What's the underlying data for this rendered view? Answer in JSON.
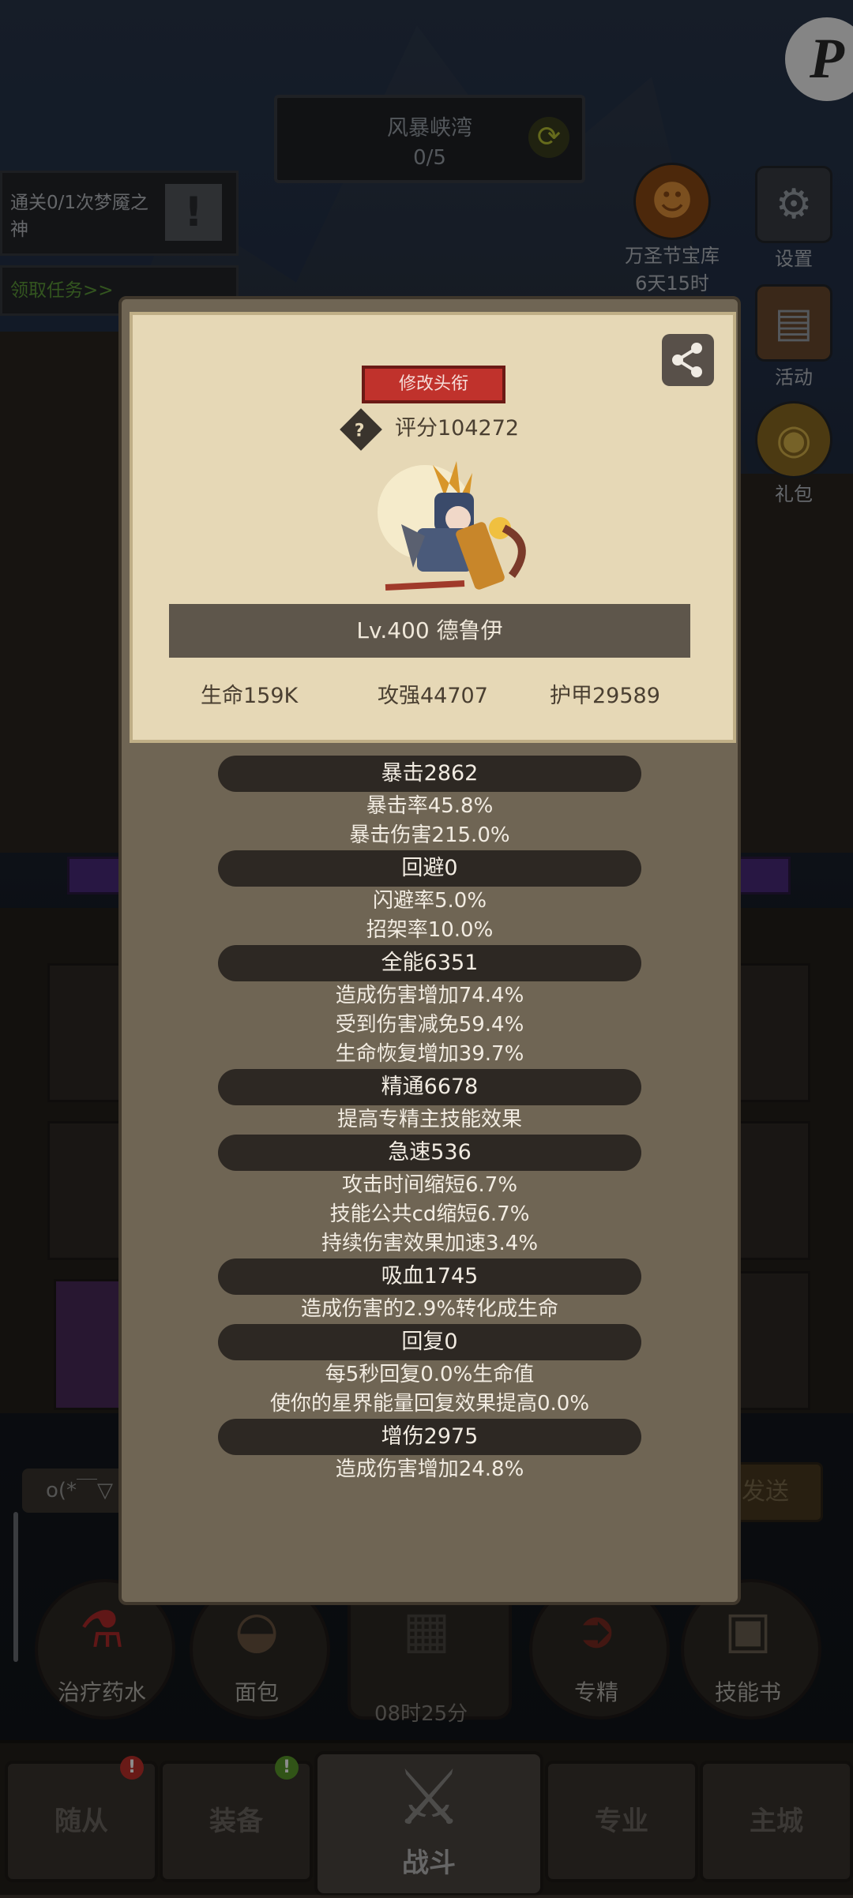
{
  "top": {
    "location": "风暴峡湾",
    "progress": "0/5"
  },
  "quests": {
    "quest1": "通关0/1次梦魇之神",
    "quest2": "领取任务>>"
  },
  "right_icons": {
    "halloween_label": "万圣节宝库",
    "halloween_time": "6天15时",
    "settings": "设置",
    "activity": "活动",
    "gift": "礼包"
  },
  "chat": {
    "text": "o(*￣▽",
    "send": "发送"
  },
  "items": {
    "potion": "治疗药水",
    "bread": "面包",
    "mastery": "专精",
    "skillbook": "技能书",
    "timer": "08时25分"
  },
  "nav": {
    "follower": "随从",
    "equipment": "装备",
    "battle": "战斗",
    "profession": "专业",
    "city": "主城"
  },
  "modal": {
    "rename_button": "修改头衔",
    "score": "评分104272",
    "hero_name": "Lv.400 德鲁伊",
    "hp": "生命159K",
    "attack": "攻强44707",
    "armor": "护甲29589",
    "stats": [
      {
        "head": "暴击2862",
        "subs": [
          "暴击率45.8%",
          "暴击伤害215.0%"
        ]
      },
      {
        "head": "回避0",
        "subs": [
          "闪避率5.0%",
          "招架率10.0%"
        ]
      },
      {
        "head": "全能6351",
        "subs": [
          "造成伤害增加74.4%",
          "受到伤害减免59.4%",
          "生命恢复增加39.7%"
        ]
      },
      {
        "head": "精通6678",
        "subs": [
          "提高专精主技能效果"
        ]
      },
      {
        "head": "急速536",
        "subs": [
          "攻击时间缩短6.7%",
          "技能公共cd缩短6.7%",
          "持续伤害效果加速3.4%"
        ]
      },
      {
        "head": "吸血1745",
        "subs": [
          "造成伤害的2.9%转化成生命"
        ]
      },
      {
        "head": "回复0",
        "subs": [
          "每5秒回复0.0%生命值",
          "使你的星界能量回复效果提高0.0%"
        ]
      },
      {
        "head": "增伤2975",
        "subs": [
          "造成伤害增加24.8%"
        ]
      }
    ]
  }
}
